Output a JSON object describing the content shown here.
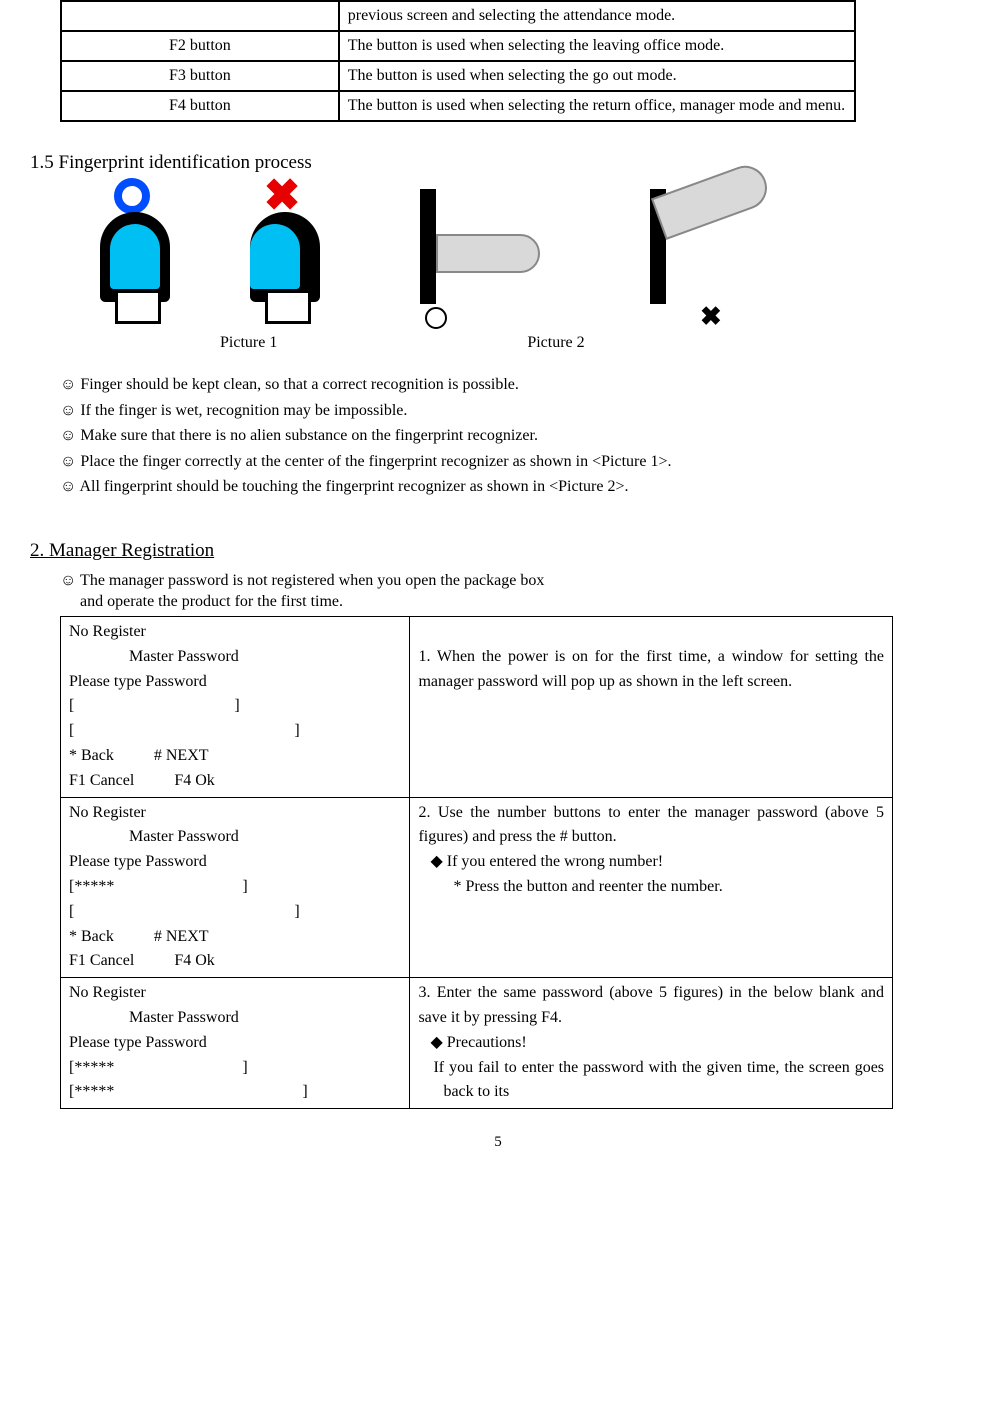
{
  "buttons_table": [
    {
      "name": "",
      "desc": "previous screen and selecting the attendance mode."
    },
    {
      "name": "F2 button",
      "desc": "The button is used when selecting\n the leaving office mode."
    },
    {
      "name": "F3 button",
      "desc": "The button is used when selecting the go\n out mode."
    },
    {
      "name": "F4 button",
      "desc": "The button is used when selecting the\n return office, manager mode and menu."
    }
  ],
  "section1_5": "1.5 Fingerprint identification process",
  "picture1_label": "Picture 1",
  "picture2_label": "Picture 2",
  "bullets": [
    "☺ Finger should be kept clean, so that a correct recognition is possible.",
    "☺ If the finger is wet, recognition may be impossible.",
    "☺ Make sure that there is no alien substance on the fingerprint recognizer.",
    "☺ Place the finger correctly at the center of the fingerprint recognizer as shown in <Picture 1>.",
    "☺ All fingerprint should be touching the fingerprint recognizer as shown in <Picture 2>."
  ],
  "section2": "2. Manager Registration",
  "section2_note1": "☺  The manager password is not registered when you open the package box",
  "section2_note2": "and operate the product for the first time.",
  "steps": [
    {
      "screen": {
        "l1": "No Register",
        "l2": "Master Password",
        "l3": "Please type Password",
        "l4": "[                                        ]",
        "l5": "[                                                       ]",
        "l6": "* Back          # NEXT",
        "l7": "F1 Cancel          F4 Ok"
      },
      "desc_main": "1. When the power is on for the first time, a window for setting the manager password will pop up as shown in the left screen.",
      "desc_sub": "",
      "desc_sub2": ""
    },
    {
      "screen": {
        "l1": "No Register",
        "l2": "Master Password",
        "l3": "Please type Password",
        "l4": "[*****                                ]",
        "l5": "[                                                       ]",
        "l6": "* Back          # NEXT",
        "l7": "F1 Cancel          F4 Ok"
      },
      "desc_main": "2. Use the number buttons to enter the manager password (above 5 figures) and press the # button.",
      "desc_sub": "◆ If you entered the wrong number!",
      "desc_sub2": "* Press the button and reenter the number."
    },
    {
      "screen": {
        "l1": "No Register",
        "l2": "Master Password",
        "l3": "Please type Password",
        "l4": "[*****                                ]",
        "l5": "[*****                                               ]",
        "l6": "",
        "l7": ""
      },
      "desc_main": "3. Enter the same password (above 5 figures) in the below blank and save it by pressing F4.",
      "desc_sub": "◆ Precautions!",
      "desc_sub2": "If you fail to enter the password with the given time, the screen goes back to its"
    }
  ],
  "page_number": "5"
}
